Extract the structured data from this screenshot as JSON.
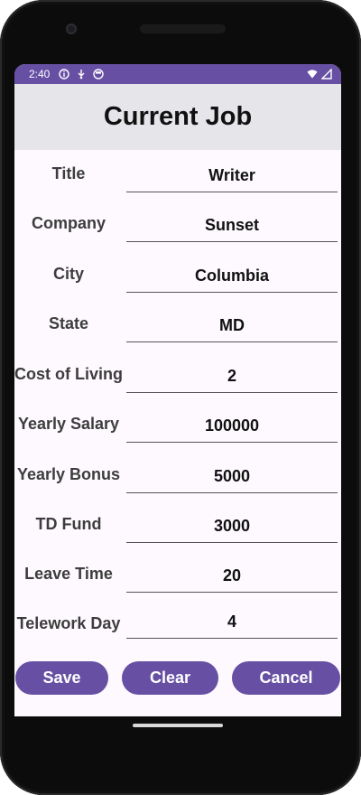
{
  "status_bar": {
    "time": "2:40",
    "icons": [
      "info-icon",
      "download-icon",
      "app-icon"
    ],
    "right_icons": [
      "wifi-icon",
      "cell-signal-icon"
    ]
  },
  "header": {
    "title": "Current Job"
  },
  "fields": [
    {
      "label": "Title",
      "value": "Writer"
    },
    {
      "label": "Company",
      "value": "Sunset"
    },
    {
      "label": "City",
      "value": "Columbia"
    },
    {
      "label": "State",
      "value": "MD"
    },
    {
      "label": "Cost of Living",
      "value": "2"
    },
    {
      "label": "Yearly Salary",
      "value": "100000"
    },
    {
      "label": "Yearly Bonus",
      "value": "5000"
    },
    {
      "label": "TD Fund",
      "value": "3000"
    },
    {
      "label": "Leave Time",
      "value": "20"
    },
    {
      "label": "Telework Day",
      "value": "4"
    }
  ],
  "buttons": {
    "save": "Save",
    "clear": "Clear",
    "cancel": "Cancel"
  },
  "colors": {
    "accent": "#6750a4",
    "header_bg": "#e6e5ea",
    "screen_bg": "#fdf9fe"
  }
}
